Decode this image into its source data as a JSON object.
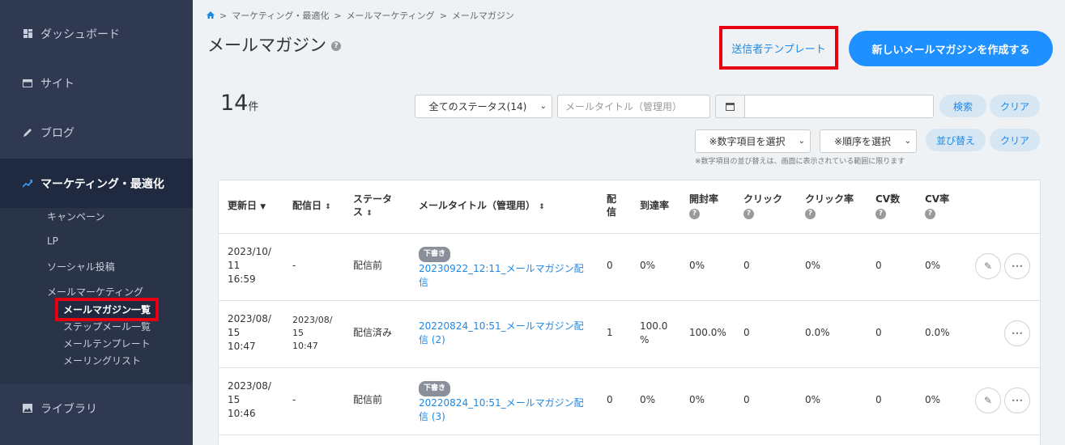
{
  "sidebar": {
    "items": [
      {
        "label": "ダッシュボード"
      },
      {
        "label": "サイト"
      },
      {
        "label": "ブログ"
      },
      {
        "label": "マーケティング・最適化"
      },
      {
        "label": "ライブラリ"
      }
    ],
    "sub": {
      "campaign": "キャンペーン",
      "lp": "LP",
      "social": "ソーシャル投稿",
      "mail_marketing": "メールマーケティング",
      "magazine_list": "メールマガジン一覧",
      "step_mail": "ステップメール一覧",
      "mail_template": "メールテンプレート",
      "mailing_list": "メーリングリスト"
    }
  },
  "breadcrumb": {
    "sep": ">",
    "items": [
      "マーケティング・最適化",
      "メールマーケティング",
      "メールマガジン"
    ]
  },
  "page": {
    "title": "メールマガジン",
    "help": "?"
  },
  "actions": {
    "sender_template": "送信者テンプレート",
    "create": "新しいメールマガジンを作成する"
  },
  "count": {
    "value": "14",
    "unit": "件"
  },
  "filters": {
    "status": "全てのステータス(14)",
    "title_placeholder": "メールタイトル（管理用）",
    "search": "検索",
    "clear": "クリア",
    "number_field": "※数字項目を選択",
    "order": "※順序を選択",
    "sort": "並び替え",
    "clear2": "クリア",
    "note": "※数字項目の並び替えは、画面に表示されている範囲に限ります"
  },
  "table": {
    "headers": {
      "updated": "更新日",
      "delivered": "配信日",
      "status_l1": "ステータ",
      "status_l2": "ス",
      "title": "メールタイトル（管理用）",
      "send_l1": "配",
      "send_l2": "信",
      "arrival": "到達率",
      "open": "開封率",
      "click": "クリック",
      "click_rate": "クリック率",
      "cv": "CV数",
      "cv_rate": "CV率",
      "q": "?"
    },
    "rows": [
      {
        "updated": [
          "2023/10/",
          "11",
          "16:59"
        ],
        "delivered": [
          "-"
        ],
        "status": "配信前",
        "badge": "下書き",
        "title": [
          "20230922_12:11_メールマガジン配",
          "信"
        ],
        "send": "0",
        "arrival": "0%",
        "open": "0%",
        "click": "0",
        "click_rate": "0%",
        "cv": "0",
        "cv_rate": "0%"
      },
      {
        "updated": [
          "2023/08/",
          "15",
          "10:47"
        ],
        "delivered": [
          "2023/08/",
          "15",
          "10:47"
        ],
        "status": "配信済み",
        "badge": "",
        "title": [
          "20220824_10:51_メールマガジン配",
          "信 (2)"
        ],
        "send": "1",
        "arrival": "100.0",
        "arrival2": "%",
        "open": "100.0%",
        "click": "0",
        "click_rate": "0.0%",
        "cv": "0",
        "cv_rate": "0.0%"
      },
      {
        "updated": [
          "2023/08/",
          "15",
          "10:46"
        ],
        "delivered": [
          "-"
        ],
        "status": "配信前",
        "badge": "下書き",
        "title": [
          "20220824_10:51_メールマガジン配",
          "信 (3)"
        ],
        "send": "0",
        "arrival": "0%",
        "open": "0%",
        "click": "0",
        "click_rate": "0%",
        "cv": "0",
        "cv_rate": "0%"
      }
    ]
  },
  "icons": {
    "more": "•••",
    "edit": "✎",
    "calendar": "▦"
  }
}
